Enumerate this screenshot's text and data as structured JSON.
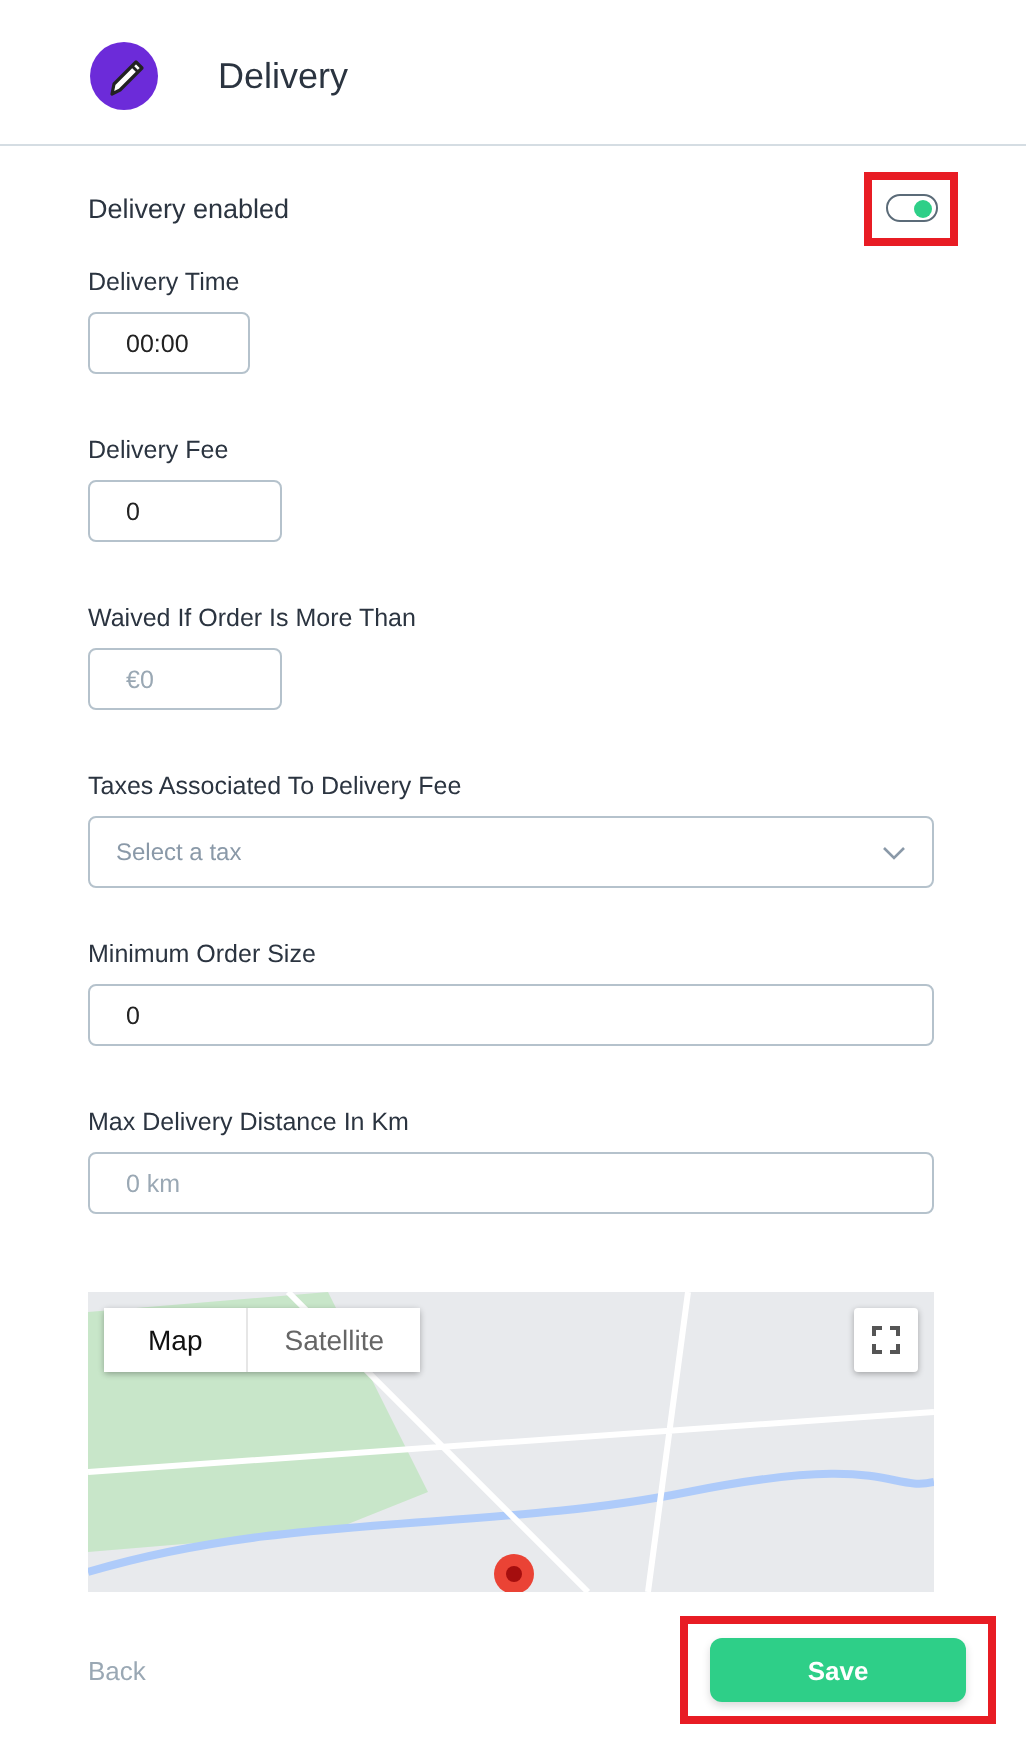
{
  "header": {
    "title": "Delivery"
  },
  "delivery_enabled": {
    "label": "Delivery enabled",
    "on": true
  },
  "fields": [
    {
      "kind": "time",
      "label": "Delivery Time",
      "value": "00:00"
    },
    {
      "kind": "short",
      "label": "Delivery Fee",
      "value": "0"
    },
    {
      "kind": "short",
      "label": "Waived If Order Is More Than",
      "placeholder": "€0"
    },
    {
      "kind": "select",
      "label": "Taxes Associated To Delivery Fee",
      "placeholder": "Select a tax"
    },
    {
      "kind": "wide",
      "label": "Minimum Order Size",
      "value": "0"
    },
    {
      "kind": "wide",
      "label": "Max Delivery Distance In Km",
      "placeholder": "0 km"
    }
  ],
  "map": {
    "tabs": [
      {
        "label": "Map",
        "selected": true
      },
      {
        "label": "Satellite",
        "selected": false
      }
    ]
  },
  "footer": {
    "back": "Back",
    "save": "Save"
  }
}
